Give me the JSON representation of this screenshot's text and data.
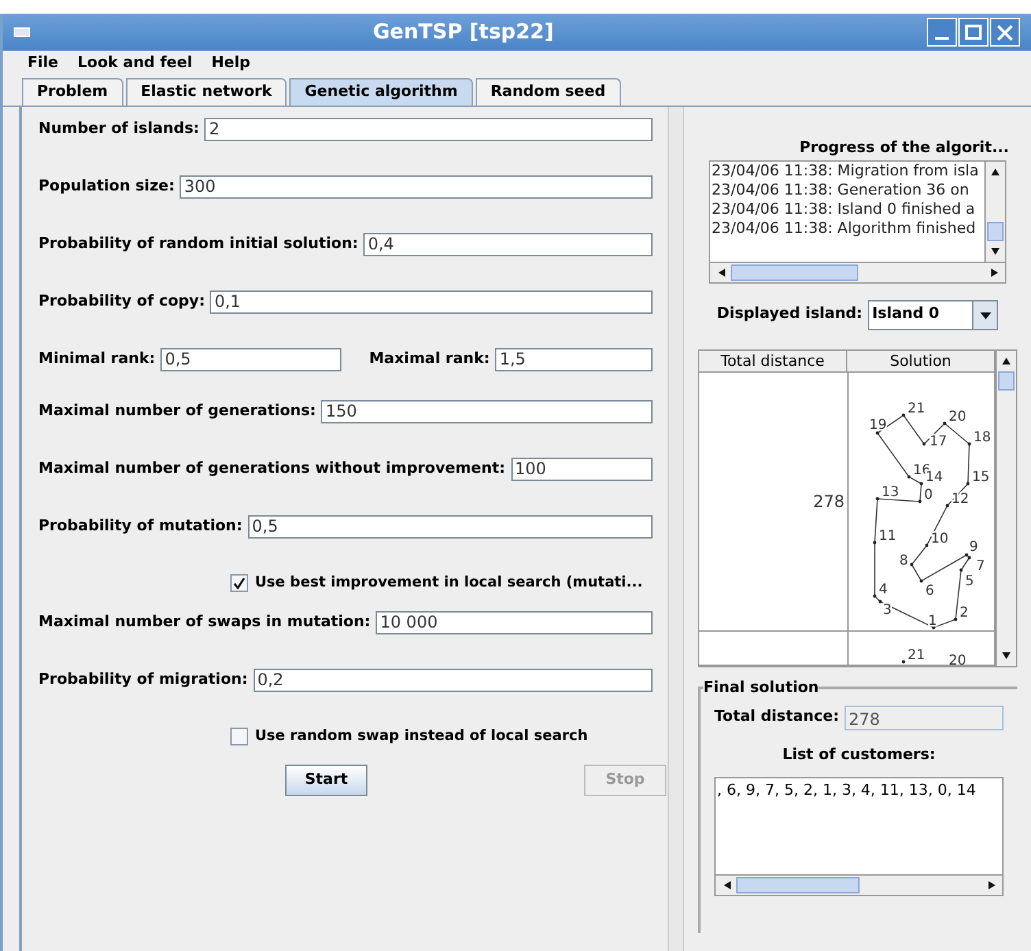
{
  "window": {
    "title": "GenTSP [tsp22]"
  },
  "menu": [
    {
      "label": "File"
    },
    {
      "label": "Look and feel"
    },
    {
      "label": "Help"
    }
  ],
  "tabs": [
    {
      "label": "Problem",
      "selected": false
    },
    {
      "label": "Elastic network",
      "selected": false
    },
    {
      "label": "Genetic algorithm",
      "selected": true
    },
    {
      "label": "Random seed",
      "selected": false
    }
  ],
  "form": [
    {
      "kind": "field",
      "label": "Number of islands:",
      "value": "2"
    },
    {
      "kind": "field",
      "label": "Population size:",
      "value": "300"
    },
    {
      "kind": "field",
      "label": "Probability of random initial solution:",
      "value": "0,4"
    },
    {
      "kind": "field",
      "label": "Probability of copy:",
      "value": "0,1"
    },
    {
      "kind": "pair",
      "fields": [
        {
          "label": "Minimal rank:",
          "value": "0,5"
        },
        {
          "label": "Maximal rank:",
          "value": "1,5"
        }
      ]
    },
    {
      "kind": "field",
      "label": "Maximal number of generations:",
      "value": "150"
    },
    {
      "kind": "field",
      "label": "Maximal number of generations without improvement:",
      "value": "100"
    },
    {
      "kind": "field",
      "label": "Probability of mutation:",
      "value": "0,5"
    },
    {
      "kind": "checkbox",
      "label": "Use best improvement in local search (mutati...",
      "checked": true
    },
    {
      "kind": "field",
      "label": "Maximal number of swaps in mutation:",
      "value": "10 000"
    },
    {
      "kind": "field",
      "label": "Probability of migration:",
      "value": "0,2"
    },
    {
      "kind": "checkbox",
      "label": "Use random swap instead of local search",
      "checked": false
    }
  ],
  "buttons": [
    {
      "label": "Start",
      "disabled": false
    },
    {
      "label": "Stop",
      "disabled": true
    }
  ],
  "progress": {
    "title": "Progress of the algorit...",
    "log": [
      "23/04/06 11:38: Migration from isla",
      "23/04/06 11:38: Generation 36 on",
      "23/04/06 11:38: Island 0 finished a",
      "23/04/06 11:38: Algorithm finished"
    ]
  },
  "island": {
    "label": "Displayed island:",
    "value": "Island 0"
  },
  "table": {
    "columns": [
      "Total distance",
      "Solution"
    ],
    "rows": [
      {
        "total_distance": "278",
        "cities": [
          "0",
          "1",
          "2",
          "3",
          "4",
          "5",
          "6",
          "7",
          "8",
          "9",
          "10",
          "11",
          "12",
          "13",
          "14",
          "15",
          "16",
          "17",
          "18",
          "19",
          "20",
          "21"
        ]
      },
      {
        "total_distance": "",
        "cities": [
          "21",
          "20"
        ]
      }
    ]
  },
  "final_solution": {
    "title": "Final solution",
    "total_label": "Total distance:",
    "total_value": "278",
    "list_label": "List of customers:",
    "list_value": ", 6, 9, 7, 5, 2, 1, 3, 4, 11, 13, 0, 14"
  }
}
